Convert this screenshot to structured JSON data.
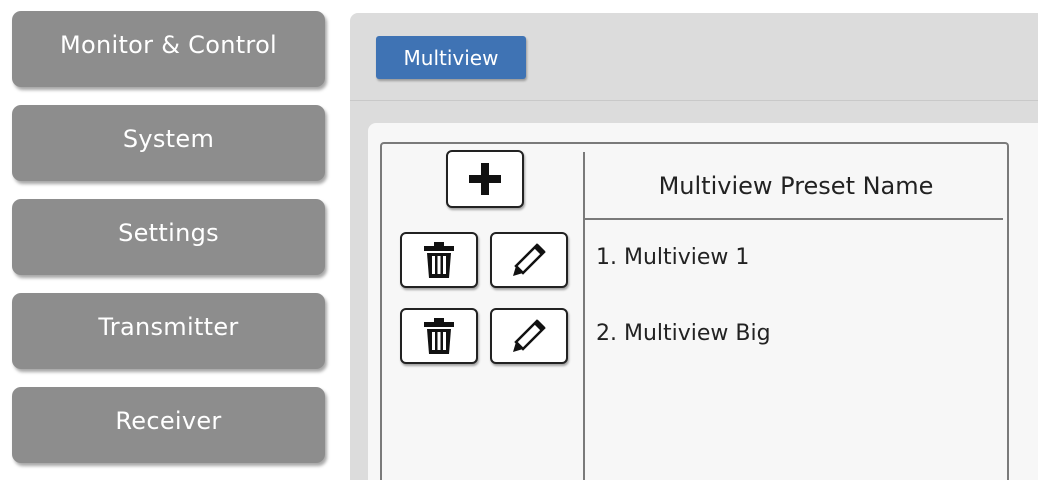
{
  "sidebar": {
    "items": [
      {
        "label": "Monitor & Control"
      },
      {
        "label": "System"
      },
      {
        "label": "Settings"
      },
      {
        "label": "Transmitter"
      },
      {
        "label": "Receiver"
      }
    ]
  },
  "main": {
    "tab_label": "Multiview",
    "table": {
      "column_header": "Multiview Preset Name",
      "rows": [
        {
          "name": "1. Multiview 1"
        },
        {
          "name": "2. Multiview Big"
        }
      ]
    }
  },
  "icons": {
    "add": "plus-icon",
    "delete": "trash-icon",
    "edit": "pencil-icon"
  },
  "colors": {
    "sidebar_button": "#8d8d8d",
    "tab_active": "#3f73b4",
    "panel": "#dcdcdc",
    "card": "#f7f7f7"
  }
}
